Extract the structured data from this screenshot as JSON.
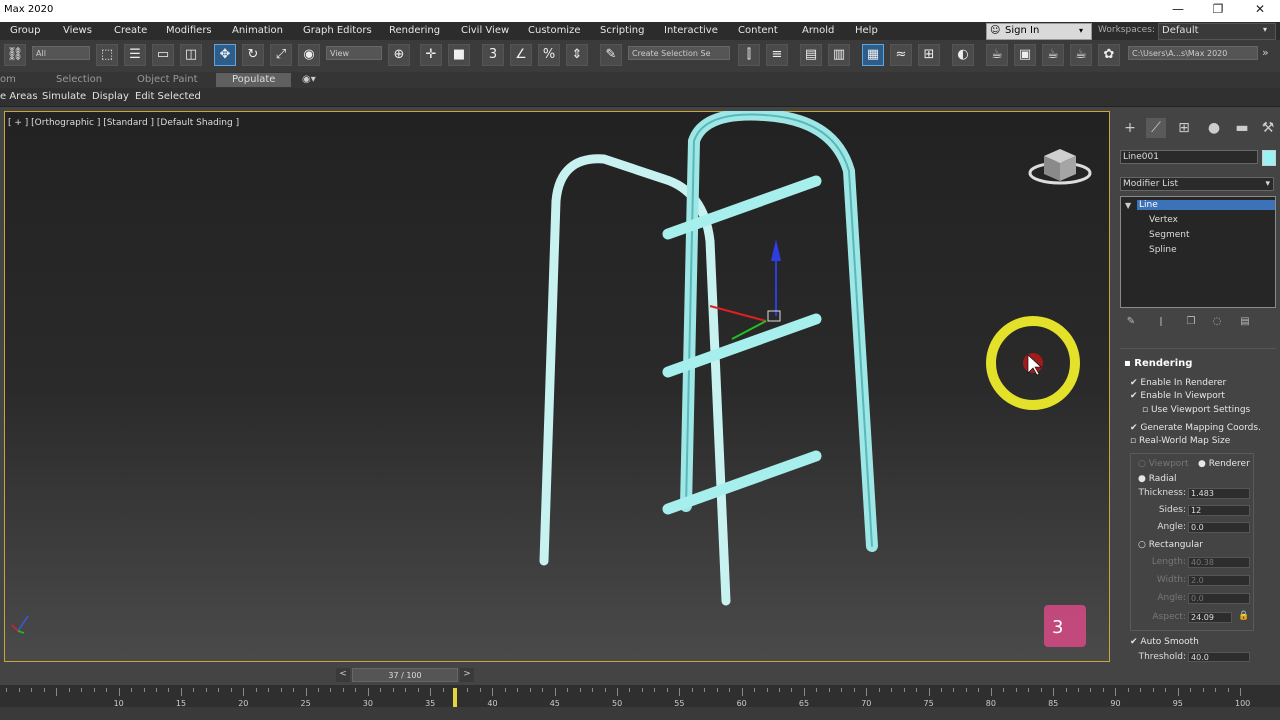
{
  "window": {
    "title": "Max 2020",
    "min_icon": "—",
    "max_icon": "❐",
    "close_icon": "✕"
  },
  "menu": {
    "items": [
      "Group",
      "Views",
      "Create",
      "Modifiers",
      "Animation",
      "Graph Editors",
      "Rendering",
      "Civil View",
      "Customize",
      "Scripting",
      "Interactive",
      "Content",
      "Arnold",
      "Help"
    ],
    "sign_in": "Sign In",
    "workspaces_label": "Workspaces:",
    "workspace_value": "Default"
  },
  "toolbar": {
    "selection_filter": "All",
    "ref_coord": "View",
    "named_selection": "Create Selection Se",
    "project_path": "C:\\Users\\A...s\\Max 2020"
  },
  "ribbon": {
    "row1": [
      "Selection",
      "Object Paint"
    ],
    "row1_partial": "om",
    "populate": "Populate",
    "row2": [
      "e Areas",
      "Simulate",
      "Display",
      "Edit Selected"
    ]
  },
  "viewport": {
    "label": "[ + ] [Orthographic ] [Standard ] [Default Shading ]",
    "object_color": "#a8f0ee"
  },
  "command_panel": {
    "object_name": "Line001",
    "modifier_list": "Modifier List",
    "stack": [
      {
        "label": "Line",
        "selected": true
      },
      {
        "label": "Vertex",
        "selected": false
      },
      {
        "label": "Segment",
        "selected": false
      },
      {
        "label": "Spline",
        "selected": false
      }
    ],
    "rollout_title": "Rendering",
    "checks": [
      {
        "label": "Enable In Renderer",
        "checked": true
      },
      {
        "label": "Enable In Viewport",
        "checked": true
      },
      {
        "label": "Use Viewport Settings",
        "checked": false
      },
      {
        "label": "Generate Mapping Coords.",
        "checked": true
      },
      {
        "label": "Real-World Map Size",
        "checked": false
      }
    ],
    "mode_viewport": "Viewport",
    "mode_renderer": "Renderer",
    "radial": "Radial",
    "thickness_label": "Thickness:",
    "thickness_value": "1.483",
    "sides_label": "Sides:",
    "sides_value": "12",
    "angle_label": "Angle:",
    "angle_value": "0.0",
    "rectangular": "Rectangular",
    "length_label": "Length:",
    "length_value": "40.38",
    "width_label": "Width:",
    "width_value": "2.0",
    "angle2_label": "Angle:",
    "angle2_value": "0.0",
    "aspect_label": "Aspect:",
    "aspect_value": "24.09",
    "auto_smooth": "Auto Smooth",
    "threshold_label": "Threshold:",
    "threshold_value": "40.0"
  },
  "timeline": {
    "frame": "37 / 100",
    "prev": "<",
    "next": ">",
    "ticks": [
      "10",
      "15",
      "20",
      "25",
      "30",
      "35",
      "40",
      "45",
      "50",
      "55",
      "60",
      "65",
      "70",
      "75",
      "80",
      "85",
      "90",
      "95",
      "100"
    ],
    "current_frame": 37
  }
}
